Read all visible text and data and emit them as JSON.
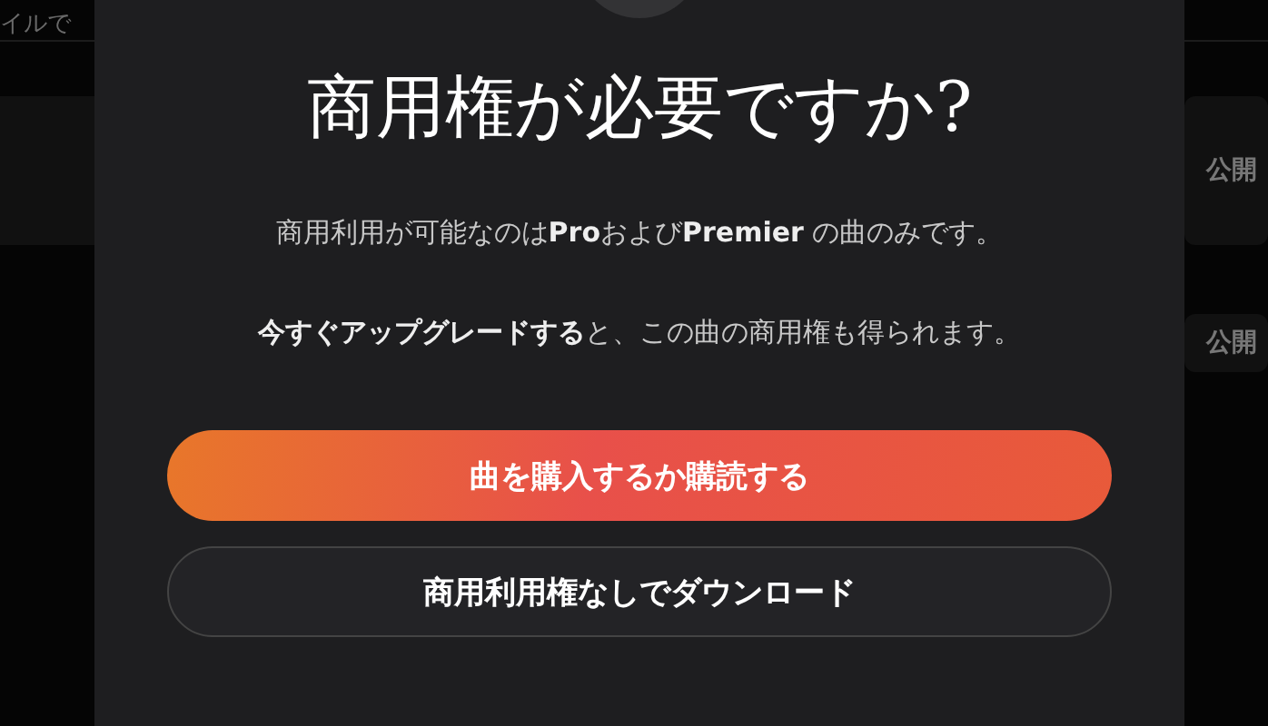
{
  "background": {
    "left_text": "イルで",
    "right_labels": [
      "公開",
      "公開"
    ]
  },
  "dialog": {
    "title": "商用権が必要ですか?",
    "paragraphs": [
      "商用利用が可能なのは**Pro**および**Premier** の曲のみです。",
      "**今すぐアップグレードする**と、この曲の商用権も得られます。"
    ],
    "buttons": [
      {
        "label": "曲を購入するか購読する",
        "kind": "primary"
      },
      {
        "label": "商用利用権なしでダウンロード",
        "kind": "secondary"
      }
    ]
  }
}
